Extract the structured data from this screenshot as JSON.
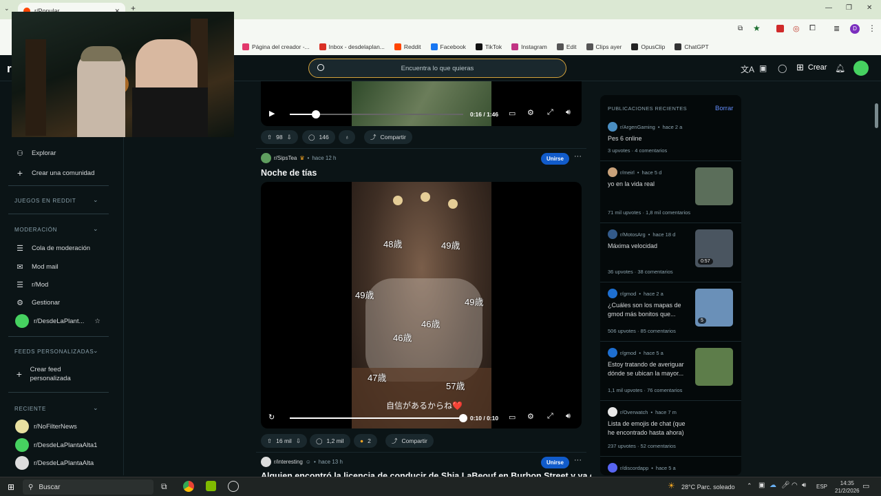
{
  "browser": {
    "tab_title": "r/Popular",
    "new_tab": "+",
    "bookmarks": [
      {
        "label": "Página del creador -...",
        "icon": "tiktok-studio-icon",
        "color": "#e2396b"
      },
      {
        "label": "Inbox - desdelaplan...",
        "icon": "gmail-icon",
        "color": "#d93025"
      },
      {
        "label": "Reddit",
        "icon": "reddit-icon",
        "color": "#ff4500"
      },
      {
        "label": "Facebook",
        "icon": "facebook-icon",
        "color": "#1877f2"
      },
      {
        "label": "TikTok",
        "icon": "tiktok-icon",
        "color": "#111111"
      },
      {
        "label": "Instagram",
        "icon": "instagram-icon",
        "color": "#c13584"
      },
      {
        "label": "Edit",
        "icon": "folder-icon",
        "color": "#555555"
      },
      {
        "label": "Clips ayer",
        "icon": "folder-icon",
        "color": "#555555"
      },
      {
        "label": "OpusClip",
        "icon": "opusclip-icon",
        "color": "#222222"
      },
      {
        "label": "ChatGPT",
        "icon": "chatgpt-icon",
        "color": "#333333"
      }
    ]
  },
  "header": {
    "search_placeholder": "Encuentra lo que quieras",
    "create_label": "Crear"
  },
  "sidebar": {
    "items_top": [
      {
        "label": "Explorar",
        "icon": "explore-icon"
      },
      {
        "label": "Crear una comunidad",
        "icon": "plus-icon"
      }
    ],
    "section_games": "JUEGOS EN REDDIT",
    "section_mod": "MODERACIÓN",
    "mod_items": [
      {
        "label": "Cola de moderación",
        "icon": "queue-icon"
      },
      {
        "label": "Mod mail",
        "icon": "mail-icon"
      },
      {
        "label": "r/Mod",
        "icon": "list-icon"
      },
      {
        "label": "Gestionar",
        "icon": "gear-icon"
      },
      {
        "label": "r/DesdeLaPlant...",
        "icon": "community-avatar"
      }
    ],
    "section_feeds": "FEEDS PERSONALIZADAS",
    "create_feed": "Crear feed personalizada",
    "section_recent": "RECIENTE",
    "recent": [
      "r/NoFilterNews",
      "r/DesdeLaPlantaAlta1",
      "r/DesdeLaPlantaAlta"
    ]
  },
  "posts": [
    {
      "video_time": "0:16 / 1:46",
      "progress": 0.15,
      "upvotes": "98",
      "comments": "146",
      "share": "Compartir"
    },
    {
      "community": "r/SipsTea",
      "time": "hace 12 h",
      "join": "Unirse",
      "title": "Noche de tías",
      "overlay_labels": [
        "48歳",
        "49歳",
        "49歳",
        "49歳",
        "46歳",
        "46歳",
        "47歳",
        "57歳"
      ],
      "caption": "自信があるからね❤️",
      "video_time": "0:10 / 0:10",
      "progress": 1.0,
      "upvotes": "16 mil",
      "comments": "1,2 mil",
      "awards": "2",
      "share": "Compartir"
    },
    {
      "community": "r/interesting",
      "time": "hace 13 h",
      "join": "Unirse",
      "title": "Alguien encontró la licencia de conducir de Shia LaBeouf en Burbon Street y ya expiró"
    }
  ],
  "recent_panel": {
    "title": "PUBLICACIONES RECIENTES",
    "clear": "Borrar",
    "items": [
      {
        "community": "r/ArgenGaming",
        "time": "hace 2 a",
        "title": "Pes 6 online",
        "upvotes": "3 upvotes",
        "comments": "4 comentarios",
        "thumb": null
      },
      {
        "community": "r/meirl",
        "time": "hace 5 d",
        "title": "yo en la vida real",
        "upvotes": "71 mil upvotes",
        "comments": "1,8 mil comentarios",
        "thumb": "#5b6e5a"
      },
      {
        "community": "r/MotosArg",
        "time": "hace 18 d",
        "title": "Máxima velocidad",
        "upvotes": "36 upvotes",
        "comments": "38 comentarios",
        "thumb": "#4a5560",
        "thumb_label": "0:57"
      },
      {
        "community": "r/gmod",
        "time": "hace 2 a",
        "title": "¿Cuáles son los mapas de gmod más bonitos que...",
        "upvotes": "506 upvotes",
        "comments": "85 comentarios",
        "thumb": "#6a90b8",
        "thumb_label": "5"
      },
      {
        "community": "r/gmod",
        "time": "hace 5 a",
        "title": "Estoy tratando de averiguar dónde se ubican la mayor...",
        "upvotes": "1,1 mil upvotes",
        "comments": "76 comentarios",
        "thumb": "#5d7d4a"
      },
      {
        "community": "r/Overwatch",
        "time": "hace 7 m",
        "title": "Lista de emojis de chat (que he encontrado hasta ahora)",
        "upvotes": "237 upvotes",
        "comments": "52 comentarios",
        "thumb": null
      },
      {
        "community": "r/discordapp",
        "time": "hace 5 a",
        "title": "",
        "upvotes": "",
        "comments": "",
        "thumb": null
      }
    ]
  },
  "taskbar": {
    "search": "Buscar",
    "weather": "28°C  Parc. soleado",
    "lang": "ESP",
    "time": "14:35",
    "date": "21/2/2026"
  }
}
